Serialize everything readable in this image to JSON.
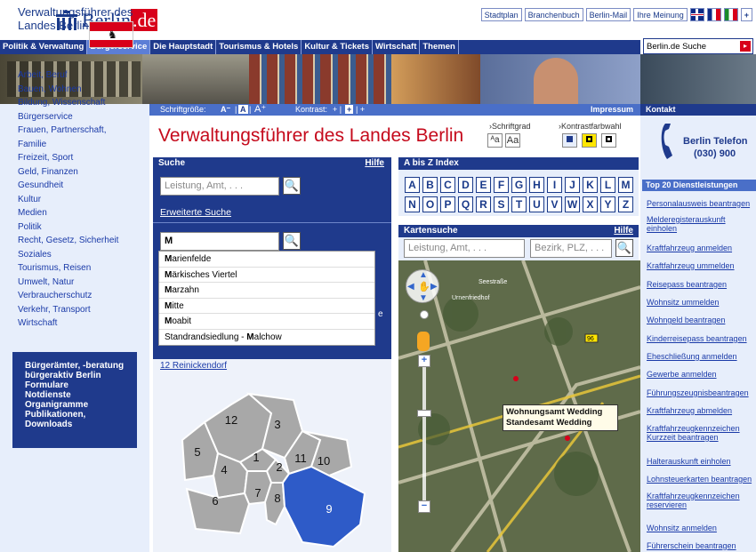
{
  "top": {
    "brand": "Berlin",
    "brand_tld": ".de",
    "links": [
      "Stadtplan",
      "Branchenbuch",
      "Berlin-Mail",
      "Ihre Meinung"
    ],
    "plus": "+",
    "search_value": "Berlin.de Suche"
  },
  "nav": [
    "Politik & Verwaltung",
    "Bürgerservice",
    "Die Hauptstadt",
    "Tourismus & Hotels",
    "Kultur & Tickets",
    "Wirtschaft",
    "Themen"
  ],
  "strip": {
    "schriftgroesse": "Schriftgröße:",
    "kontrast": "Kontrast:",
    "impressum": "Impressum",
    "kontakt": "Kontakt"
  },
  "left": {
    "title": "Verwaltungsführer des Landes Berlin",
    "items": [
      "Arbeit, Beruf",
      "Bauen, Wohnen",
      "Bildung, Wissenschaft",
      "Bürgerservice",
      "Frauen, Partnerschaft,",
      "Familie",
      "Freizeit, Sport",
      "Geld, Finanzen",
      "Gesundheit",
      "Kultur",
      "Medien",
      "Politik",
      "Recht, Gesetz, Sicherheit",
      "Soziales",
      "Tourismus, Reisen",
      "Umwelt, Natur",
      "Verbraucherschutz",
      "Verkehr, Transport",
      "Wirtschaft"
    ],
    "box_items": [
      "Bürgerämter, -beratung",
      "bürgeraktiv Berlin",
      "Formulare",
      "Notdienste",
      "Organigramme",
      "Publikationen,",
      "Downloads"
    ]
  },
  "main": {
    "page_title": "Verwaltungsführer des Landes Berlin",
    "schriftgrad": "Schriftgrad",
    "kontrastfarbwahl": "Kontrastfarbwahl",
    "suche": {
      "header": "Suche",
      "hilfe": "Hilfe",
      "placeholder": "Leistung, Amt, . . .",
      "erweiterte": "Erweiterte Suche",
      "bezirk_value": "M",
      "suggestions": [
        {
          "b": "M",
          "r": "arienfelde"
        },
        {
          "b": "M",
          "r": "ärkisches Viertel"
        },
        {
          "b": "M",
          "r": "arzahn"
        },
        {
          "b": "M",
          "r": "itte"
        },
        {
          "b": "M",
          "r": "oabit"
        },
        {
          "pre": "Standrandsiedlung - ",
          "b": "M",
          "r": "alchow"
        }
      ],
      "district_link": "12 Reinickendorf",
      "district_numbers": [
        "12",
        "3",
        "5",
        "1",
        "11",
        "10",
        "4",
        "2",
        "7",
        "8",
        "6",
        "9"
      ]
    },
    "az": {
      "header": "A bis Z Index",
      "letters": [
        "A",
        "B",
        "C",
        "D",
        "E",
        "F",
        "G",
        "H",
        "I",
        "J",
        "K",
        "L",
        "M",
        "N",
        "O",
        "P",
        "Q",
        "R",
        "S",
        "T",
        "U",
        "V",
        "W",
        "X",
        "Y",
        "Z"
      ]
    },
    "karten": {
      "header": "Kartensuche",
      "hilfe": "Hilfe",
      "placeholder1": "Leistung, Amt, . . .",
      "placeholder2": "Bezirk, PLZ, . . .",
      "tooltip1": "Wohnungsamt Wedding",
      "tooltip2": "Standesamt Wedding",
      "street1": "Urnenfriedhof",
      "street2": "Seestraße",
      "road_num": "96"
    }
  },
  "right": {
    "phone_title": "Berlin Telefon",
    "phone_number": "(030) 900",
    "header": "Top 20 Dienstleistungen",
    "links": [
      "Personalausweis beantragen",
      "Melderegisterauskunft einholen",
      "Kraftfahrzeug anmelden",
      "Kraftfahrzeug ummelden",
      "Reisepass beantragen",
      "Wohnsitz ummelden",
      "Wohngeld beantragen",
      "Kinderreisepass beantragen",
      "Eheschließung anmelden",
      "Gewerbe anmelden",
      "Führungszeugnisbeantragen",
      "Kraftfahrzeug abmelden",
      "Kraftfahrzeugkennzeichen Kurzzeit beantragen",
      "Halterauskunft einholen",
      "Lohnsteuerkarten beantragen",
      "Kraftfahrzeugkennzeichen reservieren",
      "Wohnsitz anmelden",
      "Führerschein beantragen"
    ]
  }
}
